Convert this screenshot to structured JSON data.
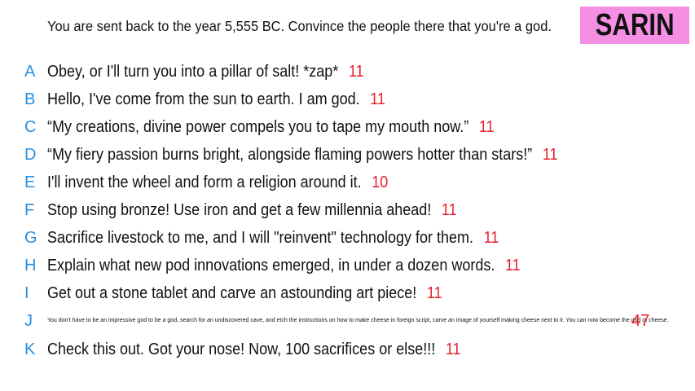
{
  "prompt": "You are sent back to the year 5,555 BC. Convince the people there that you're a god.",
  "badge": "SARIN",
  "answers": [
    {
      "letter": "A",
      "text": "Obey, or I'll turn you into a pillar of salt! *zap*",
      "score": "11"
    },
    {
      "letter": "B",
      "text": "Hello, I've come from the sun to earth. I am god.",
      "score": "11"
    },
    {
      "letter": "C",
      "text": "“My creations, divine power compels you to tape my mouth now.”",
      "score": "11"
    },
    {
      "letter": "D",
      "text": "“My fiery passion burns bright, alongside flaming powers hotter than stars!”",
      "score": "11"
    },
    {
      "letter": "E",
      "text": "I'll invent the wheel and form a religion around it.",
      "score": "10"
    },
    {
      "letter": "F",
      "text": "Stop using bronze! Use iron and get a few millennia ahead!",
      "score": "11"
    },
    {
      "letter": "G",
      "text": "Sacrifice livestock to me, and I will \"reinvent\" technology for them.",
      "score": "11"
    },
    {
      "letter": "H",
      "text": "Explain what new pod innovations emerged, in under a dozen words.",
      "score": "11"
    },
    {
      "letter": "I",
      "text": "Get out a stone tablet and carve an astounding art piece!",
      "score": "11"
    },
    {
      "letter": "J",
      "text": "You don't have to be an impressive god to be a god, search for an undiscovered cave, and etch the instructions on how to make cheese in foreign script, carve an image of yourself making cheese next to it. You can now become the god of cheese.",
      "score": "47"
    },
    {
      "letter": "K",
      "text": "Check this out. Got your nose! Now, 100 sacrifices or else!!!",
      "score": "11"
    }
  ]
}
